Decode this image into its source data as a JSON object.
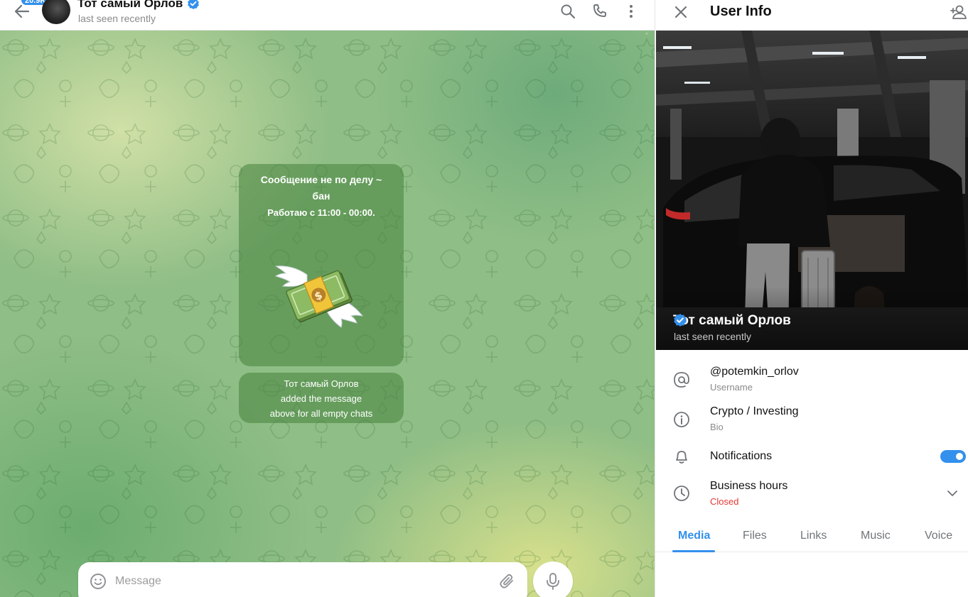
{
  "chat": {
    "unread_count": "20.9K",
    "title": "Тот самый Орлов",
    "status": "last seen recently",
    "header_icons": [
      "search-icon",
      "phone-icon",
      "more-vertical-icon"
    ],
    "welcome_message": {
      "line1": "Сообщение не по делу ~",
      "line2": "бан",
      "line3": "Работаю с 11:00 - 00:00.",
      "sticker": "flying-money-sticker"
    },
    "service_message": {
      "line1": "Тот самый Орлов",
      "line2": "added the message",
      "line3": "above for all empty chats"
    },
    "composer": {
      "placeholder": "Message"
    }
  },
  "info": {
    "title": "User Info",
    "profile": {
      "name": "Тот самый Орлов",
      "status": "last seen recently",
      "verified": true
    },
    "rows": {
      "username": {
        "value": "@potemkin_orlov",
        "label": "Username"
      },
      "bio": {
        "value": "Crypto / Investing",
        "label": "Bio"
      },
      "notifications": {
        "label": "Notifications",
        "enabled": true
      },
      "business_hours": {
        "label": "Business hours",
        "status": "Closed"
      }
    },
    "tabs": [
      "Media",
      "Files",
      "Links",
      "Music",
      "Voice"
    ],
    "active_tab": "Media"
  },
  "colors": {
    "accent": "#3390ec",
    "closed": "#e53935",
    "bubble": "#46823c"
  }
}
